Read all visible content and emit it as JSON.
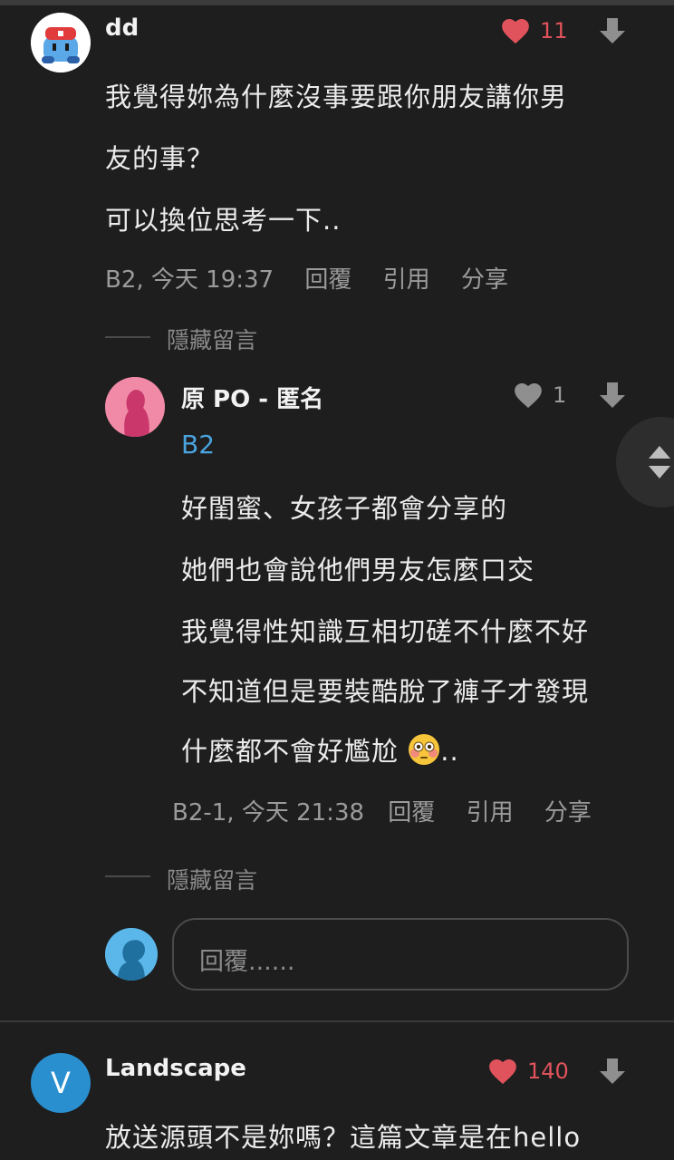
{
  "comment1": {
    "username": "dd",
    "likes": "11",
    "lines": [
      "我覺得妳為什麼沒事要跟你朋友講你男",
      "友的事？",
      "可以換位思考一下.."
    ],
    "meta": {
      "floor_time": "B2, 今天 19:37",
      "reply": "回覆",
      "quote": "引用",
      "share": "分享"
    },
    "hidden_label": "隱藏留言"
  },
  "reply1": {
    "username": "原 PO - 匿名",
    "likes": "1",
    "floor_tag": "B2",
    "lines": [
      "好閨蜜、女孩子都會分享的",
      "她們也會說他們男友怎麼口交",
      "我覺得性知識互相切磋不什麼不好",
      "不知道但是要裝酷脫了褲子才發現",
      "什麼都不會好尷尬",
      ".."
    ],
    "meta": {
      "floor_time": "B2-1, 今天 21:38",
      "reply": "回覆",
      "quote": "引用",
      "share": "分享"
    },
    "hidden_label": "隱藏留言"
  },
  "reply_input": {
    "placeholder": "回覆......"
  },
  "comment2": {
    "avatar_letter": "V",
    "username": "Landscape",
    "likes": "140",
    "lines": [
      "放送源頭不是妳嗎？這篇文章是在hello"
    ]
  },
  "colors": {
    "accent_red": "#e0535c",
    "link_blue": "#4aa3df",
    "background": "#1e1e1e"
  },
  "icons": [
    "heart-icon",
    "downvote-icon",
    "scroll-arrows-icon",
    "flushed-face-emoji"
  ]
}
